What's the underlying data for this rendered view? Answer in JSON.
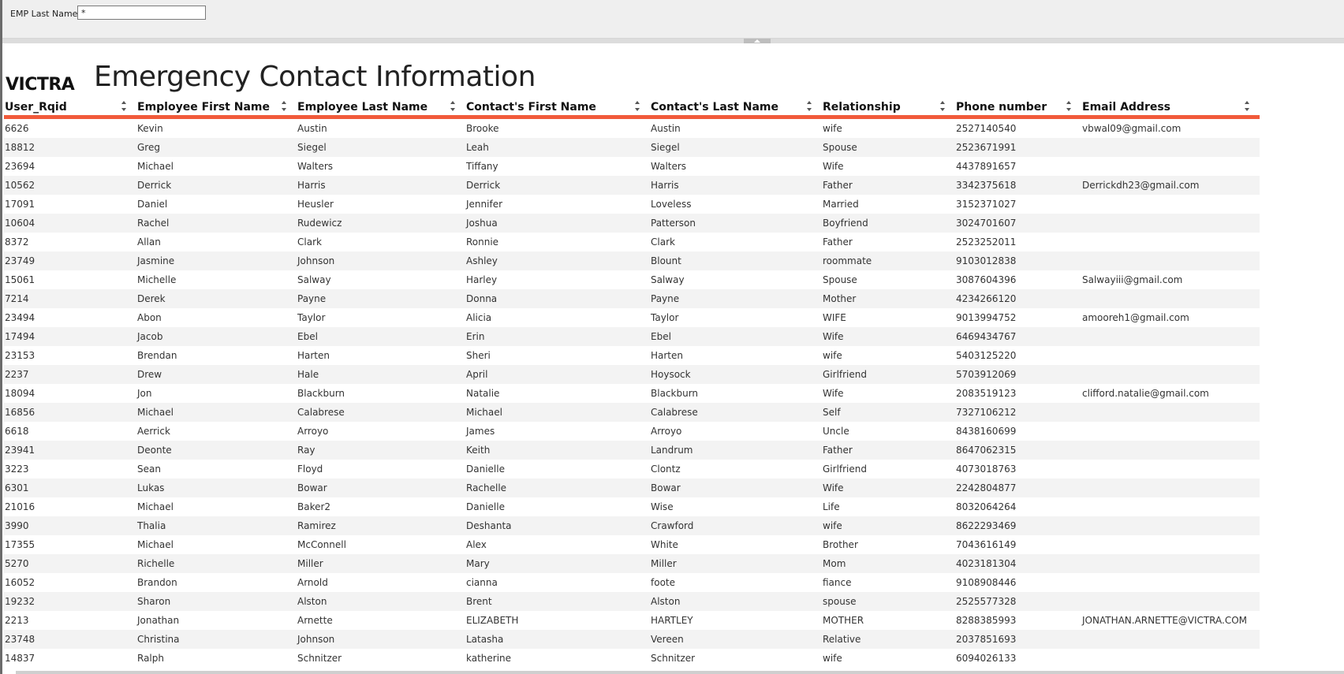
{
  "parameters": {
    "emp_last_name_label": "EMP Last Name",
    "emp_last_name_value": "*"
  },
  "logo": {
    "text": "VICTRA"
  },
  "report": {
    "title": "Emergency Contact Information"
  },
  "table": {
    "columns": [
      "User_Rqid",
      "Employee First Name",
      "Employee Last Name",
      "Contact's First Name",
      "Contact's Last Name",
      "Relationship",
      "Phone number",
      "Email Address"
    ],
    "rows": [
      [
        "6626",
        "Kevin",
        "Austin",
        "Brooke",
        "Austin",
        "wife",
        "2527140540",
        "vbwal09@gmail.com"
      ],
      [
        "18812",
        "Greg",
        "Siegel",
        "Leah",
        "Siegel",
        "Spouse",
        "2523671991",
        ""
      ],
      [
        "23694",
        "Michael",
        "Walters",
        "Tiffany",
        "Walters",
        "Wife",
        "4437891657",
        ""
      ],
      [
        "10562",
        "Derrick",
        "Harris",
        "Derrick",
        "Harris",
        "Father",
        "3342375618",
        "Derrickdh23@gmail.com"
      ],
      [
        "17091",
        "Daniel",
        "Heusler",
        "Jennifer",
        "Loveless",
        "Married",
        "3152371027",
        ""
      ],
      [
        "10604",
        "Rachel",
        "Rudewicz",
        "Joshua",
        "Patterson",
        "Boyfriend",
        "3024701607",
        ""
      ],
      [
        "8372",
        "Allan",
        "Clark",
        "Ronnie",
        "Clark",
        "Father",
        "2523252011",
        ""
      ],
      [
        "23749",
        "Jasmine",
        "Johnson",
        "Ashley",
        "Blount",
        "roommate",
        "9103012838",
        ""
      ],
      [
        "15061",
        "Michelle",
        "Salway",
        "Harley",
        "Salway",
        "Spouse",
        "3087604396",
        "Salwayiii@gmail.com"
      ],
      [
        "7214",
        "Derek",
        "Payne",
        "Donna",
        "Payne",
        "Mother",
        "4234266120",
        ""
      ],
      [
        "23494",
        "Abon",
        "Taylor",
        "Alicia",
        "Taylor",
        "WIFE",
        "9013994752",
        "amooreh1@gmail.com"
      ],
      [
        "17494",
        "Jacob",
        "Ebel",
        "Erin",
        "Ebel",
        "Wife",
        "6469434767",
        ""
      ],
      [
        "23153",
        "Brendan",
        "Harten",
        "Sheri",
        "Harten",
        "wife",
        "5403125220",
        ""
      ],
      [
        "2237",
        "Drew",
        "Hale",
        "April",
        "Hoysock",
        "Girlfriend",
        "5703912069",
        ""
      ],
      [
        "18094",
        "Jon",
        "Blackburn",
        "Natalie",
        "Blackburn",
        "Wife",
        "2083519123",
        "clifford.natalie@gmail.com"
      ],
      [
        "16856",
        "Michael",
        "Calabrese",
        "Michael",
        "Calabrese",
        "Self",
        "7327106212",
        ""
      ],
      [
        "6618",
        "Aerrick",
        "Arroyo",
        "James",
        "Arroyo",
        "Uncle",
        "8438160699",
        ""
      ],
      [
        "23941",
        "Deonte",
        "Ray",
        "Keith",
        "Landrum",
        "Father",
        "8647062315",
        ""
      ],
      [
        "3223",
        "Sean",
        "Floyd",
        "Danielle",
        "Clontz",
        "Girlfriend",
        "4073018763",
        ""
      ],
      [
        "6301",
        "Lukas",
        "Bowar",
        "Rachelle",
        "Bowar",
        "Wife",
        "2242804877",
        ""
      ],
      [
        "21016",
        "Michael",
        "Baker2",
        "Danielle",
        "Wise",
        "Life",
        "8032064264",
        ""
      ],
      [
        "3990",
        "Thalia",
        "Ramirez",
        "Deshanta",
        "Crawford",
        "wife",
        "8622293469",
        ""
      ],
      [
        "17355",
        "Michael",
        "McConnell",
        "Alex",
        "White",
        "Brother",
        "7043616149",
        ""
      ],
      [
        "5270",
        "Richelle",
        "Miller",
        "Mary",
        "Miller",
        "Mom",
        "4023181304",
        ""
      ],
      [
        "16052",
        "Brandon",
        "Arnold",
        "cianna",
        "foote",
        "fiance",
        "9108908446",
        ""
      ],
      [
        "19232",
        "Sharon",
        "Alston",
        "Brent",
        "Alston",
        "spouse",
        "2525577328",
        ""
      ],
      [
        "2213",
        "Jonathan",
        "Arnette",
        "ELIZABETH",
        "HARTLEY",
        "MOTHER",
        "8288385993",
        "JONATHAN.ARNETTE@VICTRA.COM"
      ],
      [
        "23748",
        "Christina",
        "Johnson",
        "Latasha",
        "Vereen",
        "Relative",
        "2037851693",
        ""
      ],
      [
        "14837",
        "Ralph",
        "Schnitzer",
        "katherine",
        "Schnitzer",
        "wife",
        "6094026133",
        ""
      ]
    ]
  },
  "colors": {
    "header_underline": "#f15a3a",
    "alt_row": "#f3f3f3",
    "param_bar": "#efefef"
  },
  "icons": {
    "sort": "sort-icon",
    "collapse": "chevron-up-icon"
  }
}
